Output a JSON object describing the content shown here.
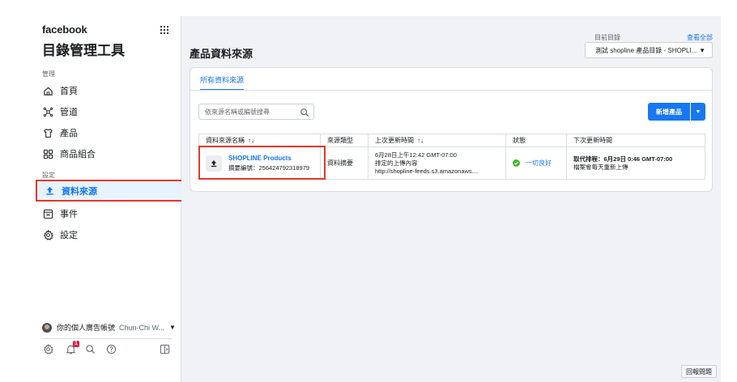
{
  "sidebar": {
    "brand": "facebook",
    "title": "目錄管理工具",
    "section_manage": "管理",
    "items_manage": [
      {
        "label": "首頁",
        "icon": "home-icon"
      },
      {
        "label": "管道",
        "icon": "channels-icon"
      },
      {
        "label": "產品",
        "icon": "shirt-icon"
      },
      {
        "label": "商品組合",
        "icon": "grid-icon"
      }
    ],
    "section_settings": "設定",
    "items_settings": [
      {
        "label": "資料來源",
        "icon": "upload-icon",
        "active": true
      },
      {
        "label": "事件",
        "icon": "events-icon"
      },
      {
        "label": "設定",
        "icon": "gear-icon"
      }
    ],
    "account_label": "你的個人廣告帳號",
    "account_name": "Chun-Chi W...",
    "notification_count": "1"
  },
  "header": {
    "catalog_label": "目前目錄",
    "view_all": "查看全部",
    "catalog_value": "測試 shopline 產品目錄 - SHOPLI..."
  },
  "main": {
    "page_title": "產品資料來源",
    "tab_all": "所有資料來源",
    "search_placeholder": "依來源名稱或編號搜尋",
    "add_button": "新增產品",
    "table": {
      "headers": [
        "資料來源名稱",
        "來源類型",
        "上次更新時間",
        "狀態",
        "下次更新時間"
      ],
      "rows": [
        {
          "name": "SHOPLINE Products",
          "id": "摘要編號：256424792318979",
          "type": "資料摘要",
          "last_update_1": "6月28日上午12:42 GMT-07:00",
          "last_update_2": "排定的上傳內容",
          "last_update_3": "http://shopline-feeds.s3.amazonaws....",
          "status": "一切良好",
          "next_1": "取代排程：6月29日 0:46 GMT-07:00",
          "next_2": "檔案會每天重新上傳"
        }
      ]
    },
    "feedback": "回報問題"
  },
  "colors": {
    "accent": "#1877f2",
    "highlight": "#e0392b",
    "ok": "#42b72a"
  }
}
